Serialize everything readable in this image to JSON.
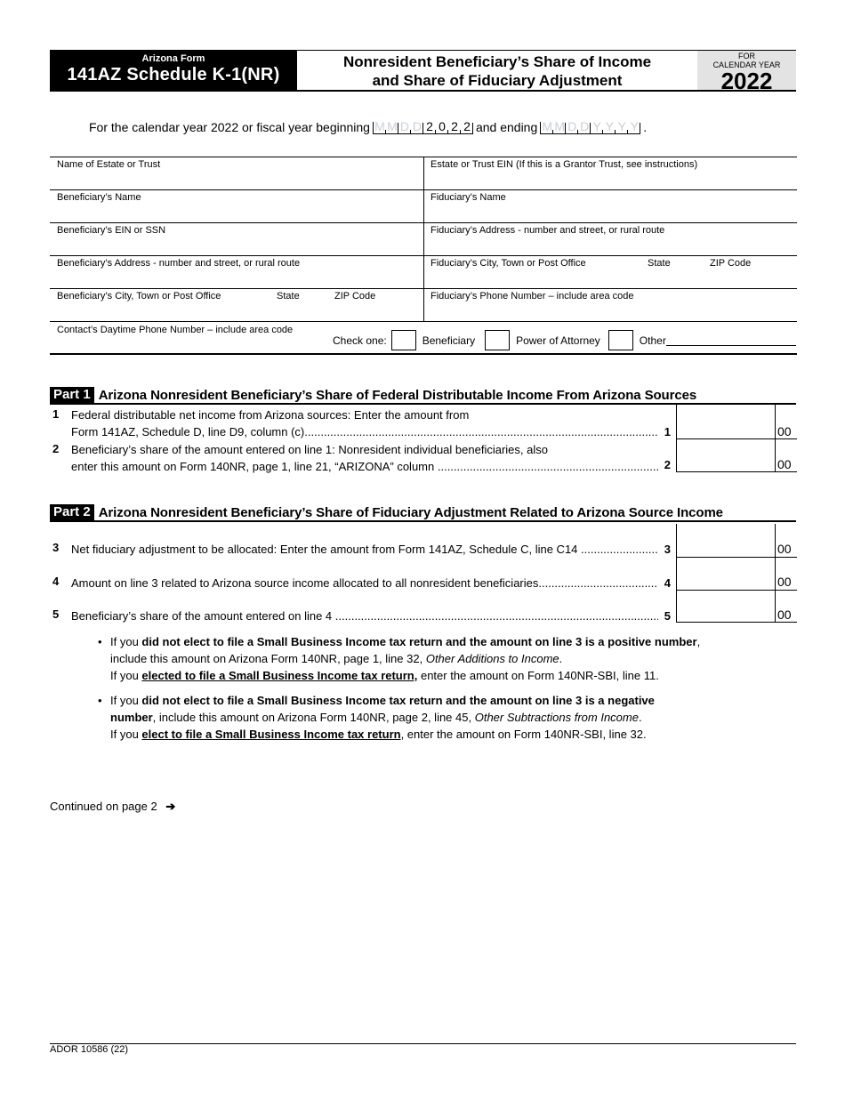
{
  "header": {
    "form_label": "Arizona Form",
    "form_name": "141AZ Schedule K-1(NR)",
    "title_line1": "Nonresident Beneficiary’s Share of Income",
    "title_line2": "and Share of Fiduciary Adjustment",
    "for_label": "FOR",
    "calendar_year_label": "CALENDAR YEAR",
    "year": "2022"
  },
  "period": {
    "prefix": "For the calendar year 2022 or fiscal year beginning",
    "begin_placeholder": [
      "M",
      "M",
      "D",
      "D"
    ],
    "begin_year": [
      "2",
      "0",
      "2",
      "2"
    ],
    "middle": "and ending",
    "end_placeholder": [
      "M",
      "M",
      "D",
      "D",
      "Y",
      "Y",
      "Y",
      "Y"
    ],
    "suffix": "."
  },
  "fields": {
    "left": [
      {
        "label": "Name of Estate or Trust"
      },
      {
        "label": "Beneficiary’s Name"
      },
      {
        "label": "Beneficiary’s EIN or SSN"
      },
      {
        "label": "Beneficiary’s Address - number and street, or rural route"
      },
      {
        "label": "Beneficiary’s City, Town or Post Office",
        "state": "State",
        "zip": "ZIP Code"
      }
    ],
    "right": [
      {
        "label": "Estate or Trust EIN (If this is a Grantor Trust, see instructions)"
      },
      {
        "label": "Fiduciary’s Name"
      },
      {
        "label": "Fiduciary’s Address - number and street, or rural route"
      },
      {
        "label": "Fiduciary’s City, Town or Post Office",
        "state": "State",
        "zip": "ZIP Code"
      },
      {
        "label": "Fiduciary’s Phone Number – include area code"
      }
    ],
    "contact_label": "Contact’s  Daytime Phone Number – include area code",
    "check_one": "Check one:",
    "options": [
      "Beneficiary",
      "Power of Attorney",
      "Other"
    ]
  },
  "part1": {
    "tag": "Part 1",
    "title": "Arizona Nonresident Beneficiary’s Share of Federal Distributable Income From Arizona Sources",
    "lines": [
      {
        "num": "1",
        "text1": "Federal distributable net income from Arizona sources:  Enter the amount from",
        "text2": "Form 141AZ, Schedule D, line D9, column (c)",
        "box": "1",
        "cents": "00"
      },
      {
        "num": "2",
        "text1": "Beneficiary’s share of the amount entered on line 1:  Nonresident individual beneficiaries, also",
        "text2": "enter this amount on Form 140NR, page 1, line 21, “ARIZONA” column",
        "box": "2",
        "cents": "00"
      }
    ]
  },
  "part2": {
    "tag": "Part 2",
    "title": "Arizona Nonresident Beneficiary’s Share of Fiduciary Adjustment Related to Arizona Source Income",
    "lines": [
      {
        "num": "3",
        "text": "Net fiduciary adjustment to be allocated:  Enter the amount from Form 141AZ, Schedule C, line C14",
        "box": "3",
        "cents": "00"
      },
      {
        "num": "4",
        "text": "Amount on line 3 related to Arizona source income allocated to all nonresident beneficiaries",
        "box": "4",
        "cents": "00"
      },
      {
        "num": "5",
        "text": "Beneficiary’s share of the amount entered on line 4",
        "box": "5",
        "cents": "00"
      }
    ]
  },
  "notes": [
    {
      "a": "If you ",
      "b": "did not elect to file a Small Business Income tax return and the amount on line 3 is a positive number",
      "c": ",",
      "line2a": "include this amount on Arizona Form 140NR, page 1, line 32, ",
      "line2i": "Other Additions to Income",
      "line2b": ".",
      "line3a": "If you ",
      "line3u": "elected to file a Small Business Income tax return,",
      "line3b": " enter the amount on Form 140NR-SBI, line 11."
    },
    {
      "a": "If you ",
      "b": "did not elect to file a Small Business Income tax return and the amount on line 3 is a negative",
      "line2bold": "number",
      "line2a": ", include this amount on Arizona Form 140NR, page 2, line 45, ",
      "line2i": "Other Subtractions from Income",
      "line2b": ".",
      "line3a": "If you ",
      "line3u": "elect to file a Small Business Income tax return",
      "line3b": ", enter the amount on Form 140NR-SBI, line 32."
    }
  ],
  "continued": "Continued on page 2",
  "footer": "ADOR 10586 (22)"
}
